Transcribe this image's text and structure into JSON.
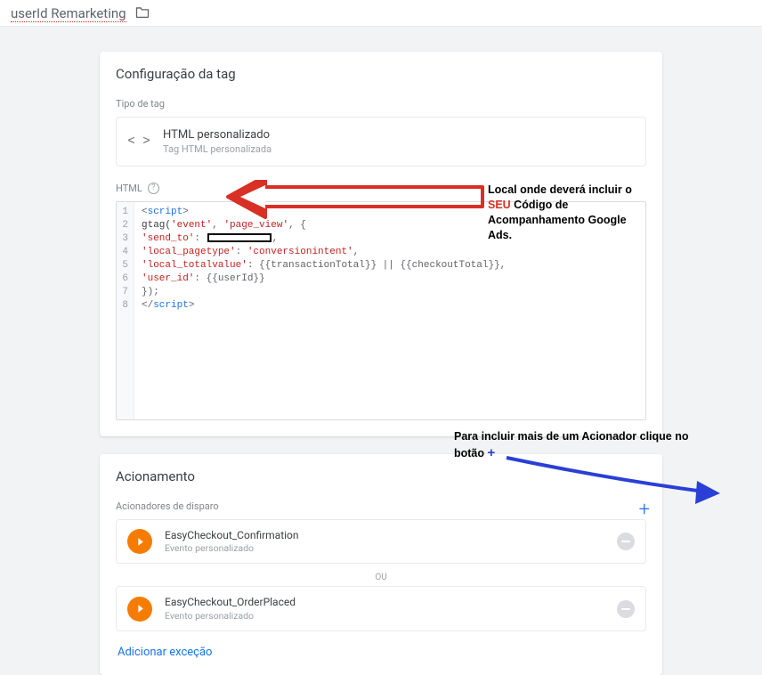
{
  "header": {
    "title": "userId Remarketing"
  },
  "config_card": {
    "title": "Configuração da tag",
    "tagtype_label": "Tipo de tag",
    "tagtype": {
      "name": "HTML personalizado",
      "sub": "Tag HTML personalizada"
    },
    "html_label": "HTML",
    "code": {
      "l1a": "<",
      "l1b": "script",
      "l1c": ">",
      "l2a": "gtag(",
      "l2b": "'event'",
      "l2c": ", ",
      "l2d": "'page_view'",
      "l2e": ", {",
      "l3a": "'send_to'",
      "l3b": ": ",
      "l3c": ",",
      "l4a": "'local_pagetype'",
      "l4b": ": ",
      "l4c": "'conversionintent'",
      "l4d": ",",
      "l5a": "'local_totalvalue'",
      "l5b": ": {{transactionTotal}} || {{checkoutTotal}},",
      "l6a": "'user_id'",
      "l6b": ": {{userId}}",
      "l7": "});",
      "l8a": "</",
      "l8b": "script",
      "l8c": ">"
    }
  },
  "annot1": {
    "prefix": "Local onde deverá incluir o ",
    "seu": "SEU",
    "suffix": " Código de Acompanhamento Google Ads."
  },
  "annot2": {
    "prefix": "Para incluir mais de um Acionador clique no botão ",
    "plus": "+"
  },
  "trigger_card": {
    "title": "Acionamento",
    "triggers_label": "Acionadores de disparo",
    "triggers": [
      {
        "name": "EasyCheckout_Confirmation",
        "sub": "Evento personalizado"
      },
      {
        "name": "EasyCheckout_OrderPlaced",
        "sub": "Evento personalizado"
      }
    ],
    "or": "ou",
    "add_exception": "Adicionar exceção"
  }
}
